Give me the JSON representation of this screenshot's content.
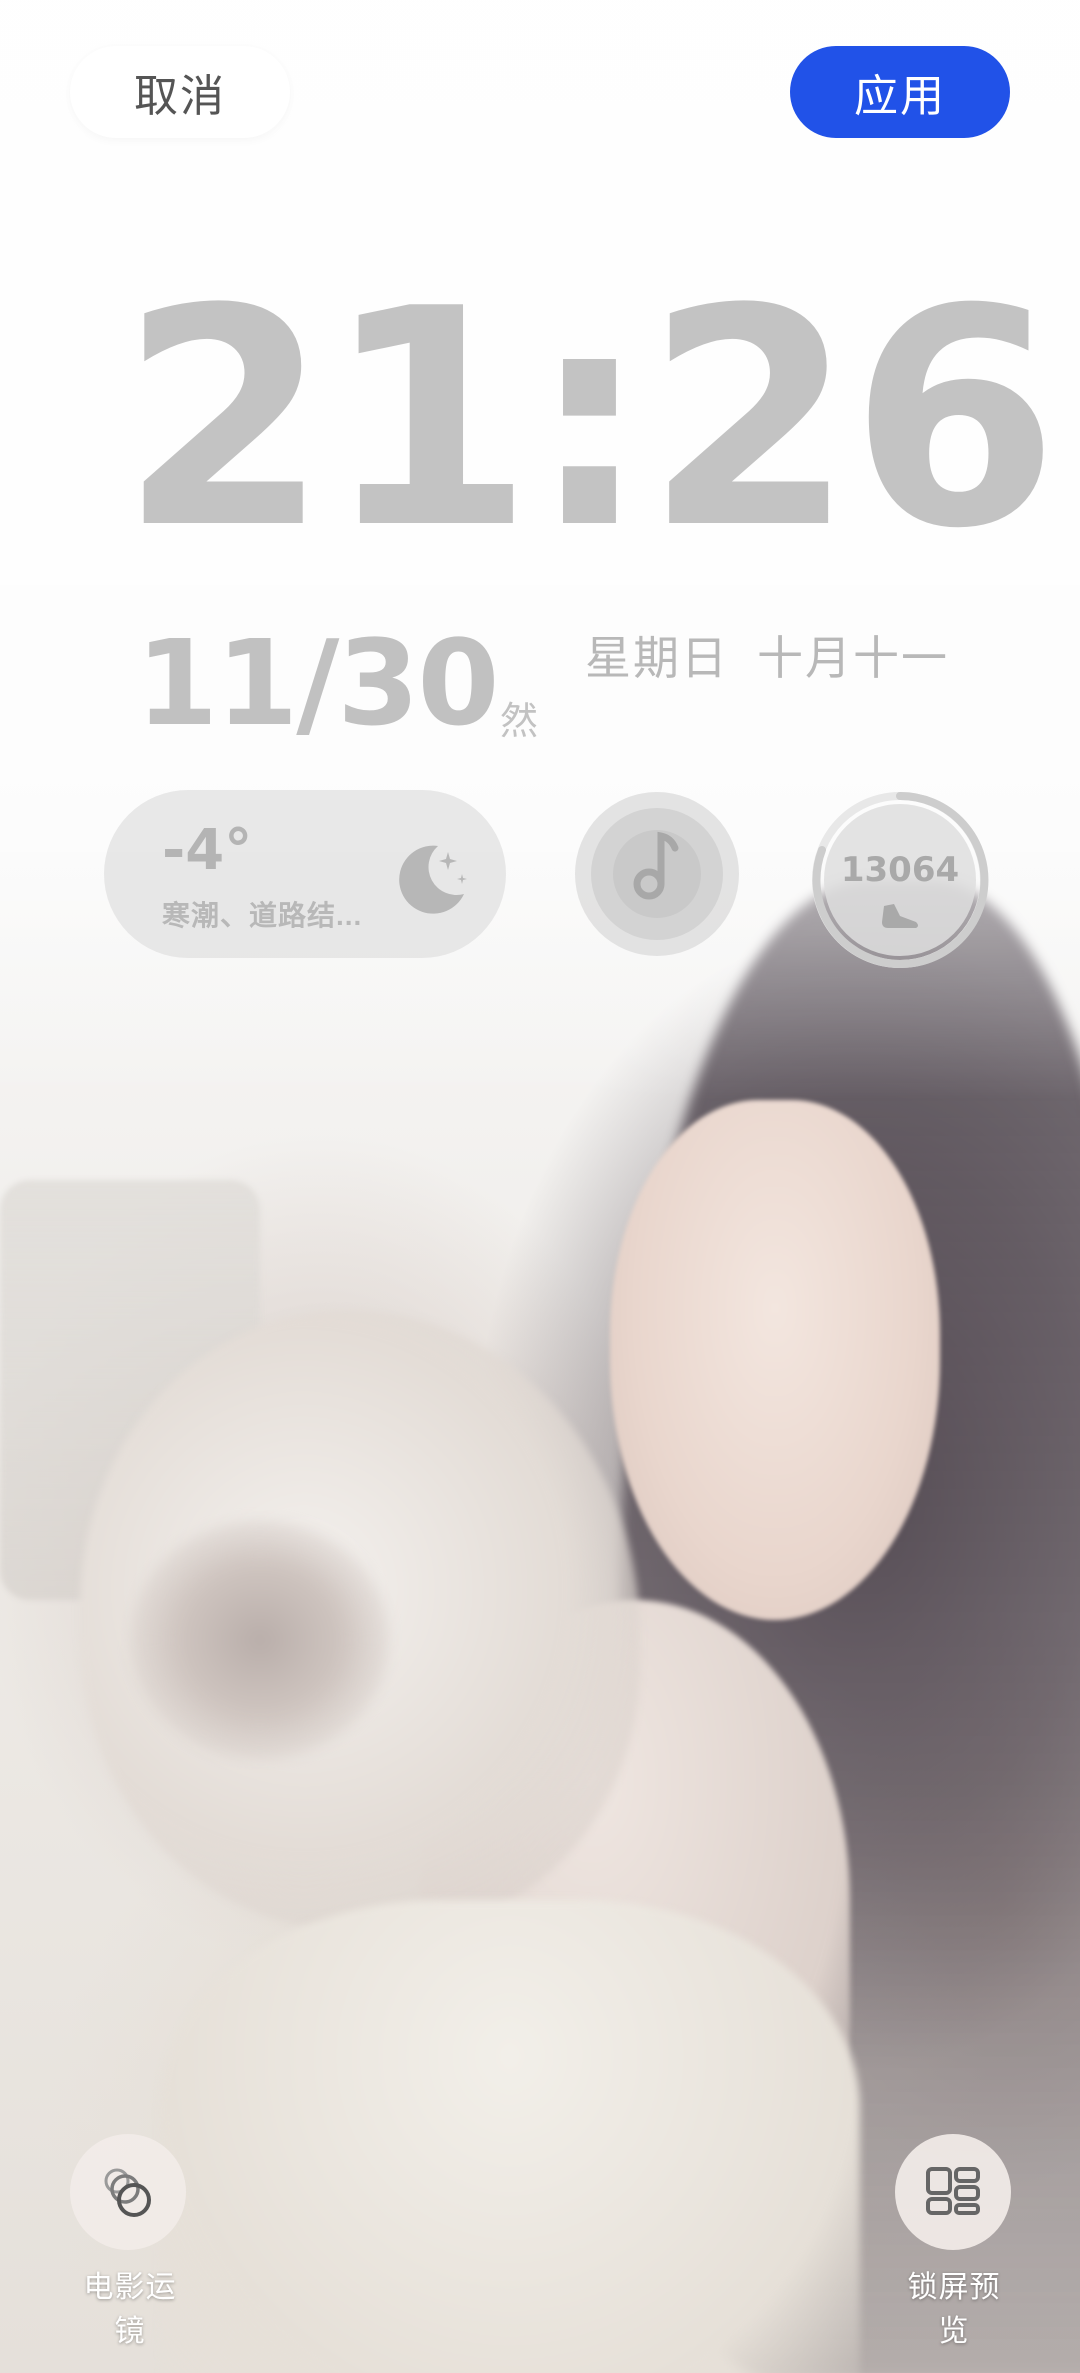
{
  "header": {
    "cancel_label": "取消",
    "apply_label": "应用"
  },
  "lockscreen": {
    "time": "21:26",
    "date": "11/30",
    "weekday": "星期日",
    "lunar": "十月十一",
    "date_fragment": "然"
  },
  "widgets": {
    "weather": {
      "temperature": "-4°",
      "description": "寒潮、道路结...",
      "icon": "moon-stars-icon"
    },
    "music": {
      "icon": "music-note-icon"
    },
    "steps": {
      "count": "13064",
      "icon": "shoe-icon"
    }
  },
  "bottom": {
    "cinematic_label": "电影运镜",
    "preview_label": "锁屏预览",
    "cinematic_icon": "cinematic-motion-icon",
    "preview_icon": "layout-grid-icon"
  },
  "colors": {
    "apply_button": "#2152e8",
    "clock_text": "#c3c3c3"
  }
}
